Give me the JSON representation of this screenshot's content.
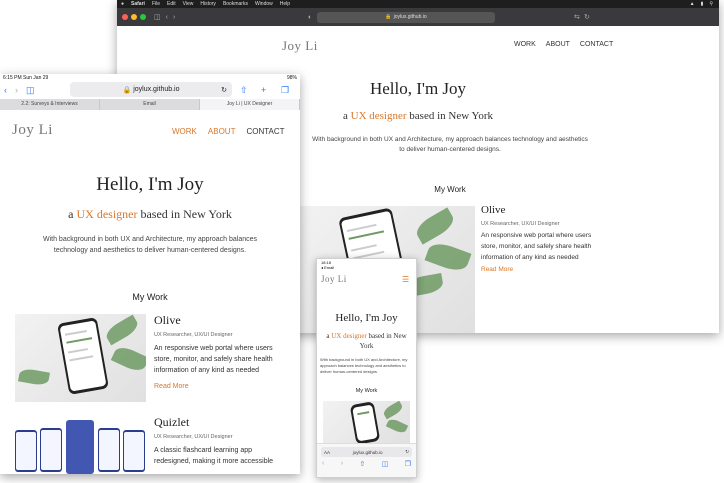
{
  "desktop": {
    "menubar": {
      "items": [
        "Safari",
        "File",
        "Edit",
        "View",
        "History",
        "Bookmarks",
        "Window",
        "Help"
      ]
    },
    "url": "joylux.github.io",
    "logo": "Joy Li",
    "nav": [
      "WORK",
      "ABOUT",
      "CONTACT"
    ],
    "hero": {
      "title": "Hello, I'm Joy",
      "subtitle_prefix": "a",
      "subtitle_highlight": "UX designer",
      "subtitle_suffix": "based in New York",
      "description": "With background in both UX and Architecture, my approach balances technology and aesthetics to deliver human-centered designs."
    },
    "section_title": "My Work",
    "project": {
      "name": "Olive",
      "role": "UX Researcher, UX/UI Designer",
      "description": "An responsive web portal where users store, monitor, and safely share health information of any kind as needed",
      "link": "Read More"
    }
  },
  "ipad": {
    "status_time": "6:15 PM  Sun Jan 29",
    "status_battery": "98%",
    "url": "joylux.github.io",
    "tabs": [
      "2.2: Surveys & Interviews",
      "Email",
      "Joy Li | UX Designer"
    ],
    "logo": "Joy Li",
    "nav": [
      "WORK",
      "ABOUT",
      "CONTACT"
    ],
    "hero": {
      "title": "Hello, I'm Joy",
      "subtitle_prefix": "a",
      "subtitle_highlight": "UX designer",
      "subtitle_suffix": "based in New York",
      "description": "With background in both UX and Architecture, my approach balances technology and aesthetics to deliver human-centered designs."
    },
    "section_title": "My Work",
    "projects": [
      {
        "name": "Olive",
        "role": "UX Researcher, UX/UI Designer",
        "description": "An responsive web portal where users store, monitor, and safely share health information of any kind as needed",
        "link": "Read More"
      },
      {
        "name": "Quizlet",
        "role": "UX Researcher, UX/UI Designer",
        "description": "A classic flashcard learning app redesigned, making it more accessible"
      }
    ]
  },
  "phone": {
    "status_time": "18:18",
    "status_back": "◂ Email",
    "logo": "Joy Li",
    "hero": {
      "title": "Hello, I'm Joy",
      "subtitle_prefix": "a",
      "subtitle_highlight": "UX designer",
      "subtitle_suffix": "based in New York",
      "description": "With background in both UX and Architecture, my approach balances technology and aesthetics to deliver human-centered designs."
    },
    "section_title": "My Work",
    "address_prefix": "AA",
    "url": "joylux.github.io"
  },
  "colors": {
    "accent": "#d9772b",
    "text": "#333333",
    "mac_toolbar": "#3a3a3c"
  }
}
